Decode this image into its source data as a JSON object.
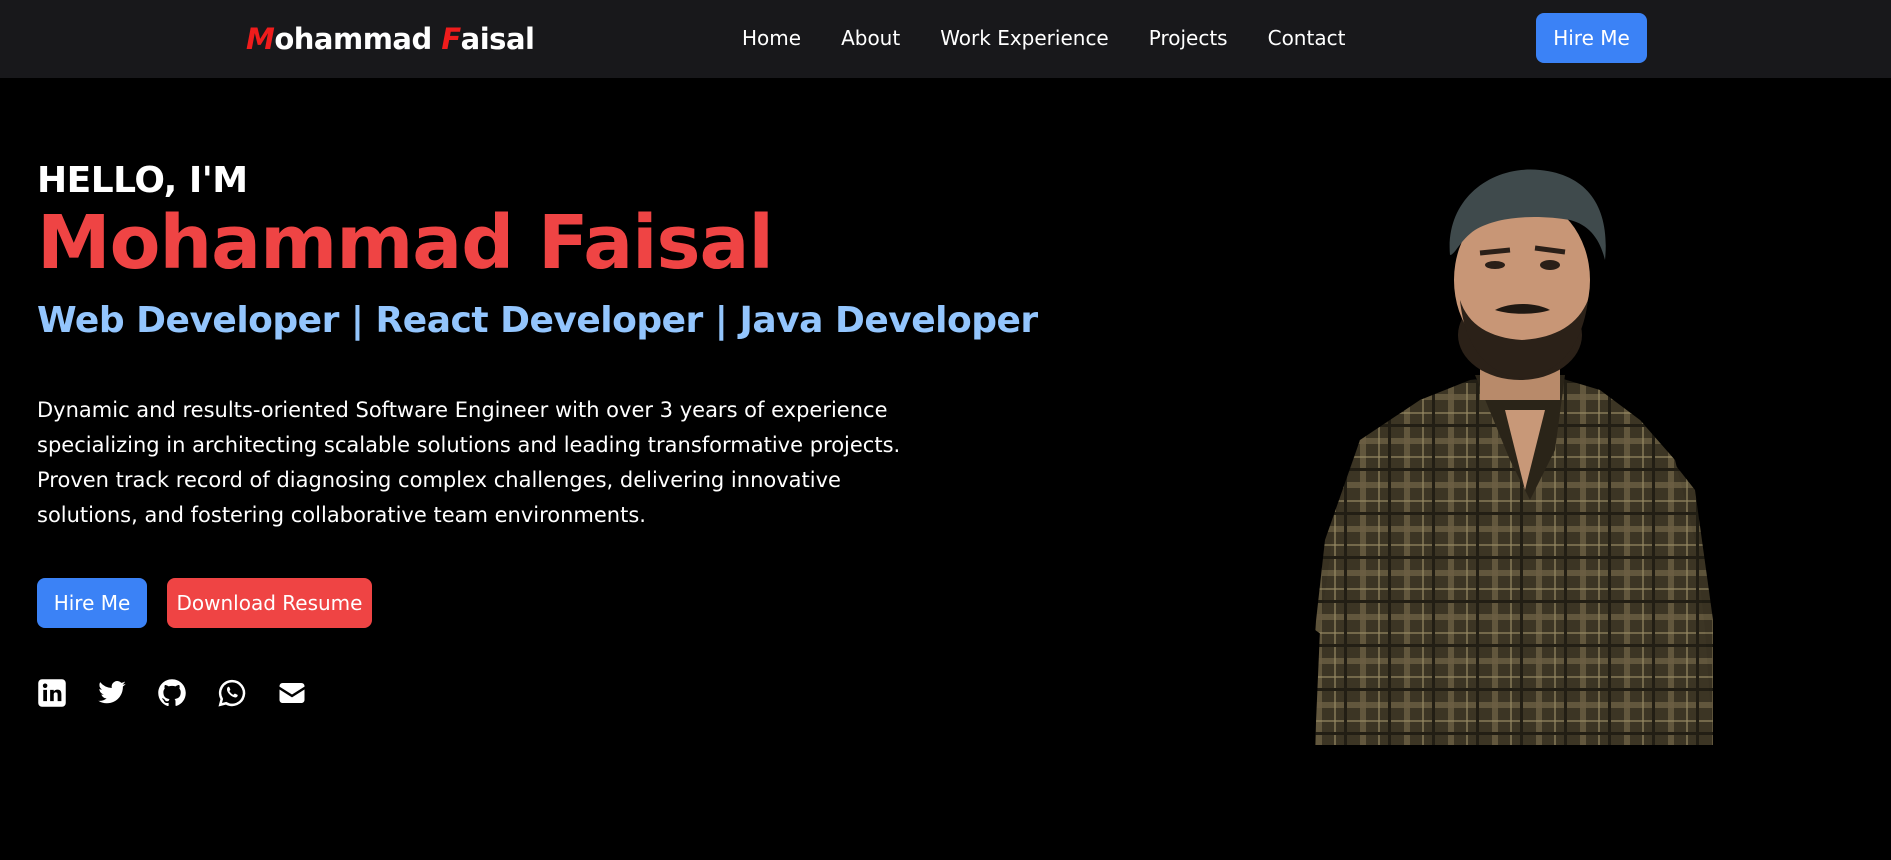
{
  "nav": {
    "logo_m": "M",
    "logo_rest1": "ohammad ",
    "logo_f": "F",
    "logo_rest2": "aisal",
    "links": [
      "Home",
      "About",
      "Work Experience",
      "Projects",
      "Contact"
    ],
    "hire_label": "Hire Me"
  },
  "hero": {
    "greeting": "HELLO, I'M",
    "name": "Mohammad Faisal",
    "roles": "Web Developer | React Developer | Java Developer",
    "bio": "Dynamic and results-oriented Software Engineer with over 3 years of experience specializing in architecting scalable solutions and leading transformative projects. Proven track record of diagnosing complex challenges, delivering innovative solutions, and fostering collaborative team environments.",
    "hire_label": "Hire Me",
    "resume_label": "Download Resume"
  },
  "socials": [
    "linkedin-icon",
    "twitter-icon",
    "github-icon",
    "whatsapp-icon",
    "email-icon"
  ],
  "colors": {
    "accent_blue": "#3b82f6",
    "accent_red": "#ef4444",
    "role_blue": "#93c5fd",
    "nav_bg": "#18181b"
  }
}
